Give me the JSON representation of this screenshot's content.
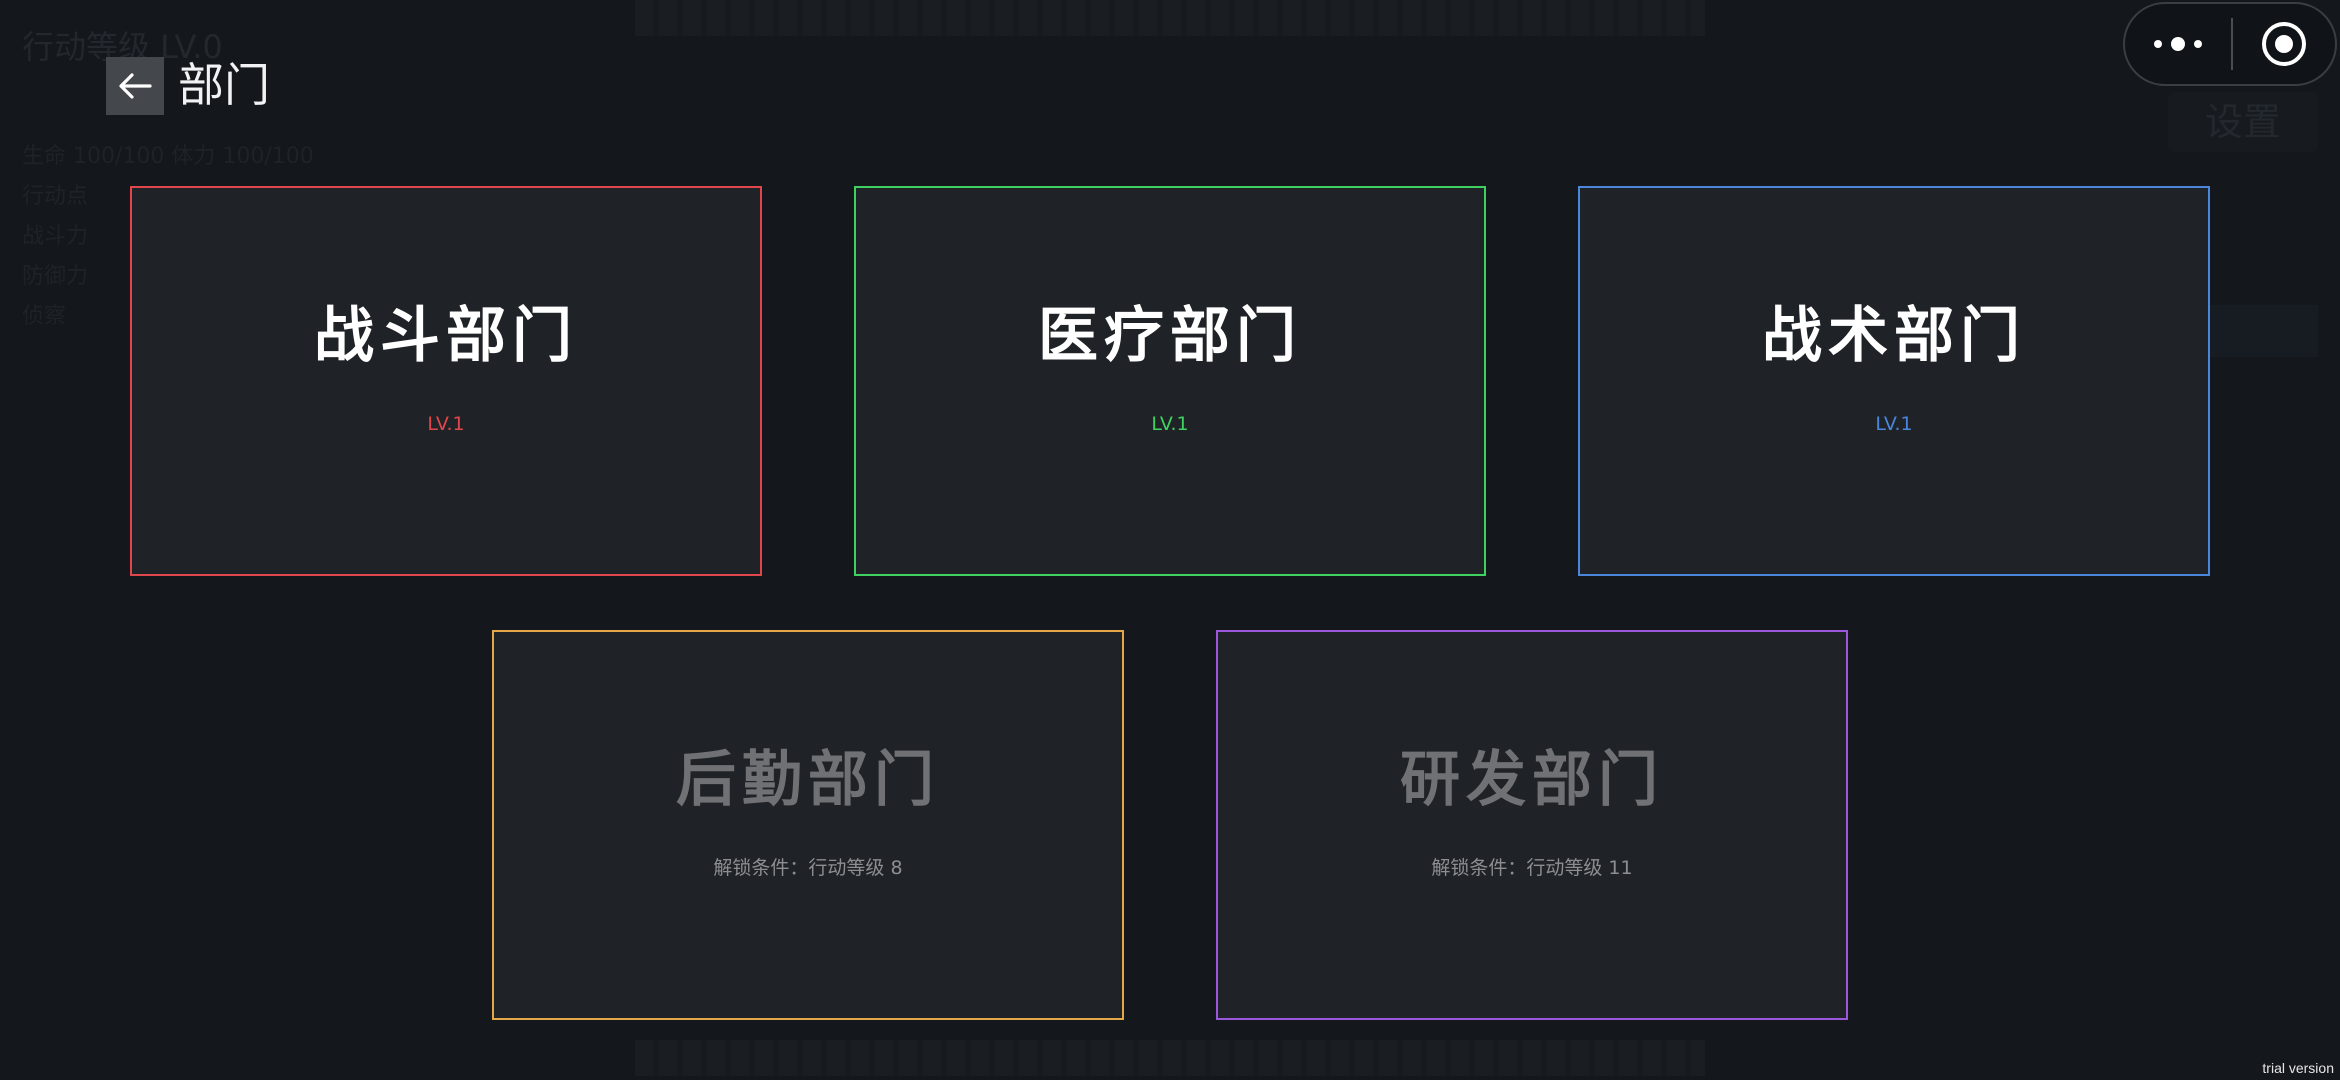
{
  "header": {
    "back_icon": "arrow-left-icon",
    "title": "部门"
  },
  "capsule": {
    "more_icon": "more-dots-icon",
    "close_icon": "target-circle-icon"
  },
  "background": {
    "title": "行动等级 LV.0",
    "lines": [
      "生命 100/100 体力 100/100",
      "行动点",
      "战斗力",
      "防御力",
      "侦察"
    ],
    "right_button": "设置"
  },
  "departments": [
    {
      "name": "战斗部门",
      "status": "LV.1",
      "locked": false,
      "color": "#e0464c"
    },
    {
      "name": "医疗部门",
      "status": "LV.1",
      "locked": false,
      "color": "#3fd160"
    },
    {
      "name": "战术部门",
      "status": "LV.1",
      "locked": false,
      "color": "#4a86dc"
    },
    {
      "name": "后勤部门",
      "status": "解锁条件：行动等级 8",
      "locked": true,
      "color": "#e6a748"
    },
    {
      "name": "研发部门",
      "status": "解锁条件：行动等级 11",
      "locked": true,
      "color": "#9b58dd"
    }
  ],
  "watermark": "trial version"
}
